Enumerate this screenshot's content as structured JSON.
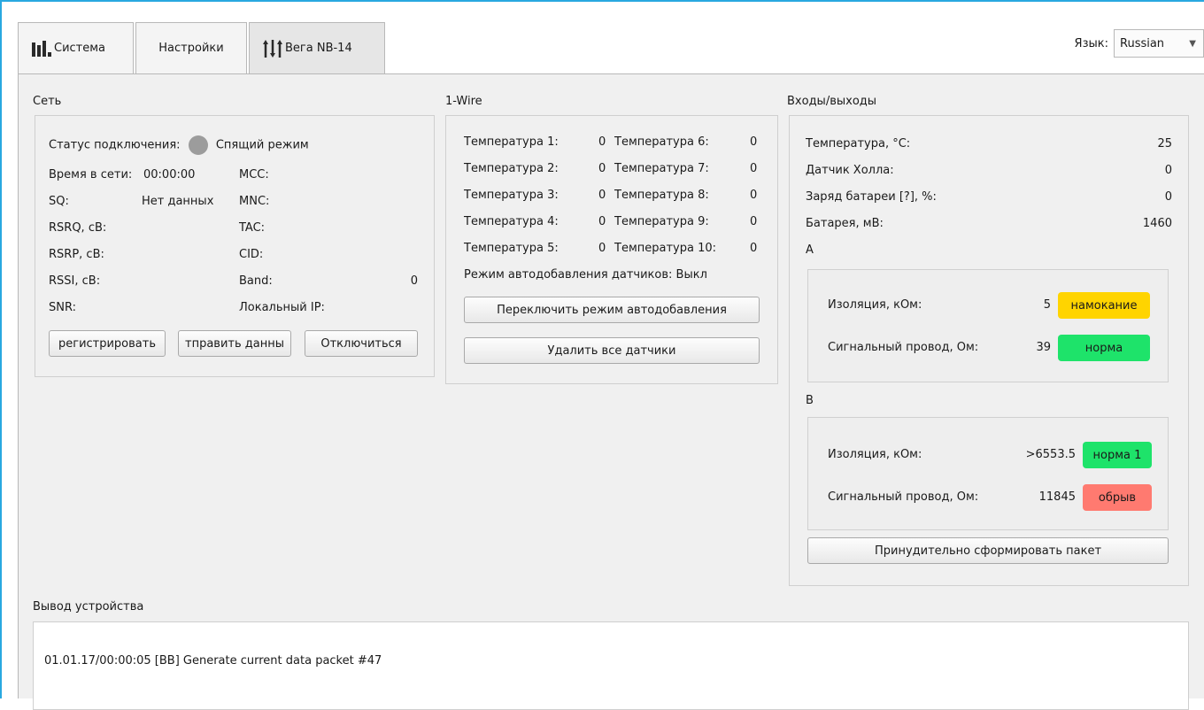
{
  "tabs": [
    {
      "label": "Система",
      "icon": "bar-chart-icon"
    },
    {
      "label": "Настройки"
    },
    {
      "label": "Вега NB-14",
      "icon": "sliders-icon"
    }
  ],
  "language": {
    "label": "Язык:",
    "value": "Russian"
  },
  "network": {
    "title": "Сеть",
    "status_label": "Статус подключения:",
    "status_value": "Спящий режим",
    "status_color": "#9c9c9c",
    "left": [
      {
        "label": "Время в сети:",
        "value": "00:00:00"
      },
      {
        "label": "SQ:",
        "value": "Нет данных"
      },
      {
        "label": "RSRQ, сB:",
        "value": ""
      },
      {
        "label": "RSRP, сB:",
        "value": ""
      },
      {
        "label": "RSSI, сB:",
        "value": ""
      },
      {
        "label": "SNR:",
        "value": ""
      }
    ],
    "right": [
      {
        "label": "MCC:",
        "value": ""
      },
      {
        "label": "MNC:",
        "value": ""
      },
      {
        "label": "TAC:",
        "value": ""
      },
      {
        "label": "CID:",
        "value": ""
      },
      {
        "label": "Band:",
        "value": "0"
      },
      {
        "label": "Локальный IP:",
        "value": ""
      }
    ],
    "buttons": [
      "регистрировать",
      "тправить данны",
      "Отключиться"
    ]
  },
  "onewire": {
    "title": "1-Wire",
    "temps": [
      {
        "label": "Температура 1:",
        "value": "0"
      },
      {
        "label": "Температура 2:",
        "value": "0"
      },
      {
        "label": "Температура 3:",
        "value": "0"
      },
      {
        "label": "Температура 4:",
        "value": "0"
      },
      {
        "label": "Температура 5:",
        "value": "0"
      },
      {
        "label": "Температура 6:",
        "value": "0"
      },
      {
        "label": "Температура 7:",
        "value": "0"
      },
      {
        "label": "Температура 8:",
        "value": "0"
      },
      {
        "label": "Температура 9:",
        "value": "0"
      },
      {
        "label": "Температура 10:",
        "value": "0"
      }
    ],
    "auto_mode_label": "Режим автодобавления датчиков:",
    "auto_mode_value": "Выкл",
    "toggle_button": "Переключить режим автодобавления",
    "delete_button": "Удалить все датчики"
  },
  "io": {
    "title": "Входы/выходы",
    "rows": [
      {
        "label": "Температура, °С:",
        "value": "25"
      },
      {
        "label": "Датчик Холла:",
        "value": "0"
      },
      {
        "label": "Заряд батареи [?], %:",
        "value": "0"
      },
      {
        "label": "Батарея, мВ:",
        "value": "1460"
      }
    ],
    "channel_a": {
      "title": "A",
      "insulation_label": "Изоляция, кОм:",
      "insulation_value": "5",
      "insulation_status": "намокание",
      "insulation_color": "#ffd400",
      "wire_label": "Сигнальный провод, Ом:",
      "wire_value": "39",
      "wire_status": "норма",
      "wire_color": "#1ee36a"
    },
    "channel_b": {
      "title": "B",
      "insulation_label": "Изоляция, кОм:",
      "insulation_value": ">6553.5",
      "insulation_status": "норма 1",
      "insulation_color": "#1ee36a",
      "wire_label": "Сигнальный провод, Ом:",
      "wire_value": "11845",
      "wire_status": "обрыв",
      "wire_color": "#ff7a70"
    },
    "force_button": "Принудительно сформировать пакет"
  },
  "device_output": {
    "title": "Вывод устройства",
    "lines": [
      "01.01.17/00:00:05 [BB] Generate current data packet #47"
    ]
  }
}
